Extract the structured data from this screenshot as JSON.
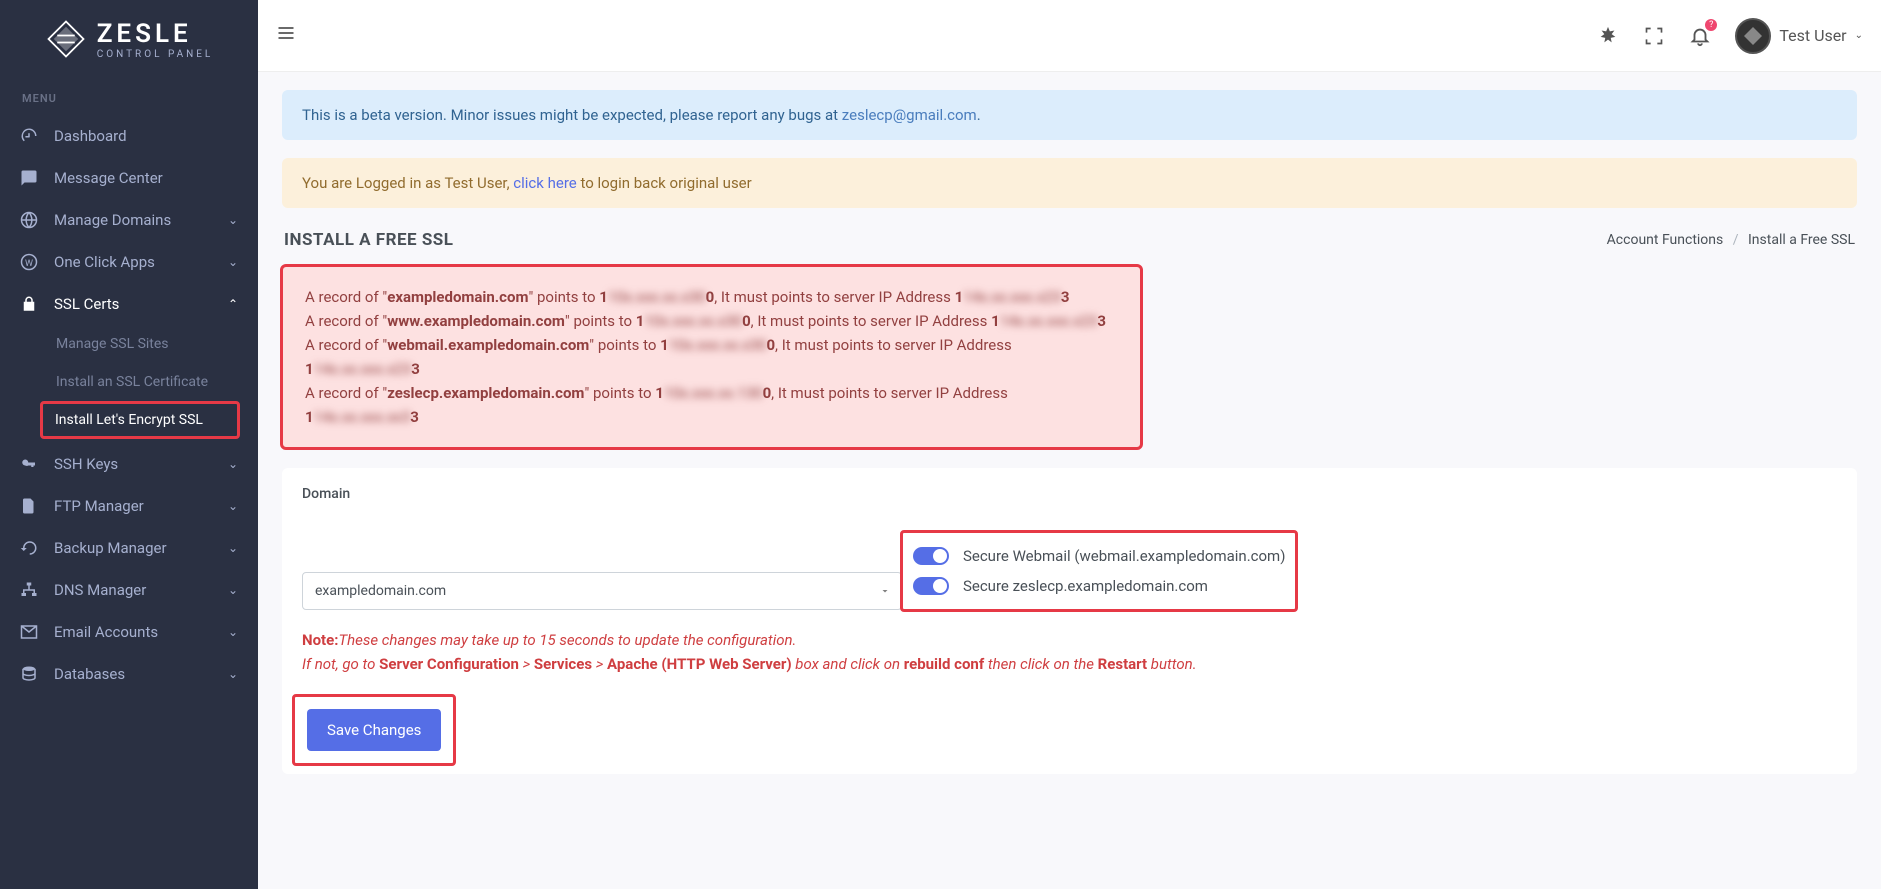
{
  "brand": {
    "name": "ZESLE",
    "sub": "CONTROL PANEL"
  },
  "sidebar": {
    "menu_label": "MENU",
    "items": [
      {
        "label": "Dashboard"
      },
      {
        "label": "Message Center"
      },
      {
        "label": "Manage Domains"
      },
      {
        "label": "One Click Apps"
      },
      {
        "label": "SSL Certs"
      },
      {
        "label": "SSH Keys"
      },
      {
        "label": "FTP Manager"
      },
      {
        "label": "Backup Manager"
      },
      {
        "label": "DNS Manager"
      },
      {
        "label": "Email Accounts"
      },
      {
        "label": "Databases"
      }
    ],
    "ssl_sub": [
      {
        "label": "Manage SSL Sites"
      },
      {
        "label": "Install an SSL Certificate"
      },
      {
        "label": "Install Let's Encrypt SSL"
      }
    ]
  },
  "topbar": {
    "bell_badge": "?",
    "user_name": "Test User"
  },
  "alerts": {
    "beta_pre": "This is a beta version. Minor issues might be expected, please report any bugs at ",
    "beta_link": "zeslecp@gmail.com",
    "beta_post": ".",
    "login_pre": "You are Logged in as Test User, ",
    "login_link": "click here",
    "login_post": " to login back original user"
  },
  "page": {
    "title": "INSTALL A FREE SSL",
    "crumb1": "Account Functions",
    "crumb2": "Install a Free SSL"
  },
  "dns_errors": [
    {
      "domain": "exampledomain.com",
      "points": "10x.xxx.xx.x30",
      "must": "14x.xx.xxx.x23"
    },
    {
      "domain": "www.exampledomain.com",
      "points": "10x.xxx.xx.x30",
      "must": "14x.xx.xxx.x23"
    },
    {
      "domain": "webmail.exampledomain.com",
      "points": "10x.xxx.xx.x30",
      "must": "14x.xx.xxx.x23"
    },
    {
      "domain": "zeslecp.exampledomain.com",
      "points": "10x.xxx.xx.130",
      "must": "14x.xx.xxx.xx3"
    }
  ],
  "form": {
    "domain_label": "Domain",
    "domain_value": "exampledomain.com",
    "toggle1": "Secure Webmail (webmail.exampledomain.com)",
    "toggle2": "Secure zeslecp.exampledomain.com",
    "note_label": "Note:",
    "note_l1": "These changes may take up to 15 seconds to update the configuration.",
    "note_l2a": "If not, go to ",
    "note_l2b": "Server Configuration",
    "note_l2c": " > ",
    "note_l2d": "Services",
    "note_l2e": " > ",
    "note_l2f": "Apache (HTTP Web Server)",
    "note_l2g": " box and click on ",
    "note_l2h": "rebuild conf",
    "note_l2i": " then click on the ",
    "note_l2j": "Restart",
    "note_l2k": " button.",
    "save": "Save Changes"
  }
}
